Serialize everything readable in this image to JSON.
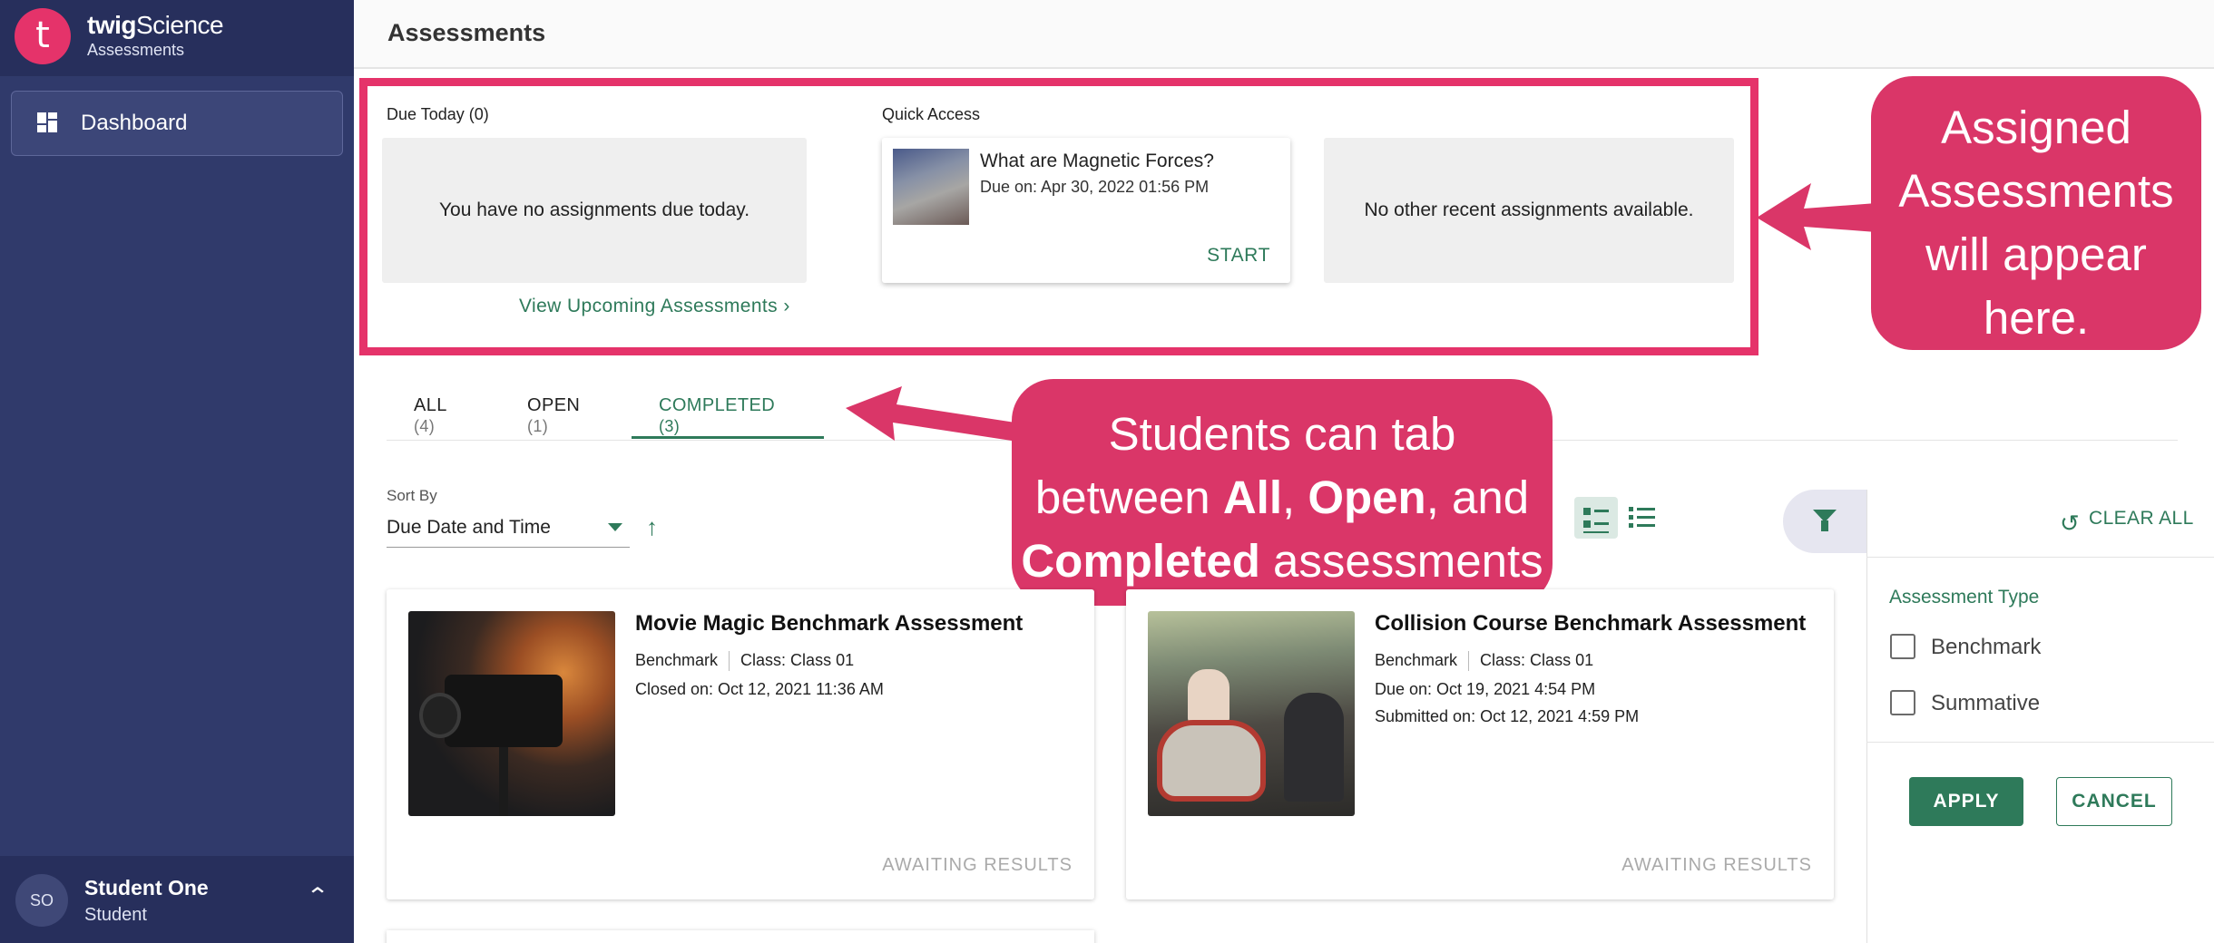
{
  "sidebar": {
    "brand_name_bold": "twig",
    "brand_name_rest": "Science",
    "brand_sub": "Assessments",
    "logo_letter": "t",
    "nav": [
      {
        "label": "Dashboard",
        "icon": "dashboard-icon"
      }
    ],
    "user": {
      "initials": "SO",
      "name": "Student One",
      "role": "Student"
    }
  },
  "header": {
    "title": "Assessments"
  },
  "overview": {
    "due_today_label": "Due Today (0)",
    "due_today_empty": "You have no assignments due today.",
    "view_upcoming": "View Upcoming Assessments",
    "quick_access_label": "Quick Access",
    "quick_card": {
      "title": "What are Magnetic Forces?",
      "due": "Due on: Apr 30, 2022 01:56 PM",
      "action": "START"
    },
    "no_other": "No other recent assignments available."
  },
  "callouts": {
    "assigned": [
      "Assigned",
      "Assessments",
      "will appear",
      "here."
    ],
    "tabs": {
      "line1": "Students can tab",
      "line2_a": "between ",
      "line2_all": "All",
      "line2_b": ", ",
      "line2_open": "Open",
      "line2_c": ", and",
      "line3_completed": "Completed",
      "line3_rest": " assessments"
    }
  },
  "tabs": [
    {
      "label": "ALL",
      "count": "(4)"
    },
    {
      "label": "OPEN",
      "count": "(1)"
    },
    {
      "label": "COMPLETED",
      "count": "(3)",
      "active": true
    }
  ],
  "sort": {
    "label": "Sort By",
    "value": "Due Date and Time"
  },
  "filter": {
    "clear_all": "CLEAR ALL",
    "section_label": "Assessment Type",
    "options": [
      {
        "label": "Benchmark",
        "checked": false
      },
      {
        "label": "Summative",
        "checked": false
      }
    ],
    "apply": "APPLY",
    "cancel": "CANCEL"
  },
  "cards": [
    {
      "title": "Movie Magic Benchmark Assessment",
      "type": "Benchmark",
      "class": "Class: Class 01",
      "lines": [
        "Closed on: Oct 12, 2021 11:36 AM"
      ],
      "status": "AWAITING RESULTS"
    },
    {
      "title": "Collision Course Benchmark Assessment",
      "type": "Benchmark",
      "class": "Class: Class 01",
      "lines": [
        "Due on: Oct 19, 2021 4:54 PM",
        "Submitted on: Oct 12, 2021 4:59 PM"
      ],
      "status": "AWAITING RESULTS"
    }
  ],
  "colors": {
    "brand_pink": "#e5336a",
    "sidebar": "#303a6b",
    "accent_green": "#2e7a5a",
    "callout": "#da3668"
  }
}
